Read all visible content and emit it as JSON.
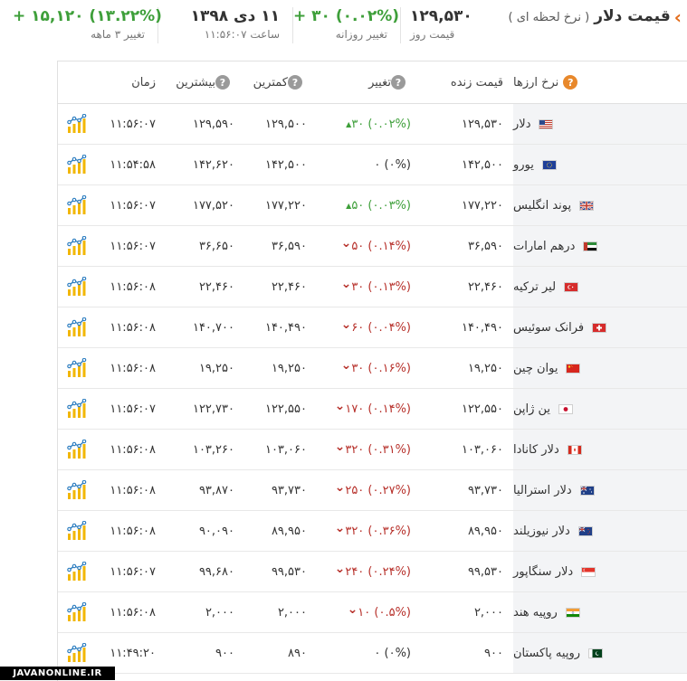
{
  "header": {
    "title": "قیمت دلار",
    "subtitle": "( نرخ لحظه ای )",
    "price": "۱۲۹,۵۳۰",
    "price_label": "قیمت روز",
    "daily_change": "+ ۳۰ (۰.۰۲%)",
    "daily_change_label": "تغییر روزانه",
    "date": "۱۱ دی ۱۳۹۸",
    "time_label": "ساعت ۱۱:۵۶:۰۷",
    "change_3m": "+ ۱۵,۱۲۰ (۱۳.۲۲%)",
    "change_3m_label": "تغییر ۳ ماهه",
    "accent": "#e36c1a",
    "up_color": "#3e9f3a",
    "down_color": "#b7312b"
  },
  "columns": {
    "name": "نرخ ارزها",
    "price": "قیمت زنده",
    "change": "تغییر",
    "min": "کمترین",
    "max": "بیشترین",
    "time": "زمان"
  },
  "rows": [
    {
      "name": "دلار",
      "flag": "us",
      "price": "۱۲۹,۵۳۰",
      "change": "۳۰ (۰.۰۲%)",
      "dir": "up",
      "min": "۱۲۹,۵۰۰",
      "max": "۱۲۹,۵۹۰",
      "time": "۱۱:۵۶:۰۷"
    },
    {
      "name": "یورو",
      "flag": "eu",
      "price": "۱۴۲,۵۰۰",
      "change": "۰ (۰%)",
      "dir": "none",
      "min": "۱۴۲,۵۰۰",
      "max": "۱۴۲,۶۲۰",
      "time": "۱۱:۵۴:۵۸"
    },
    {
      "name": "پوند انگلیس",
      "flag": "gb",
      "price": "۱۷۷,۲۲۰",
      "change": "۵۰ (۰.۰۳%)",
      "dir": "up",
      "min": "۱۷۷,۲۲۰",
      "max": "۱۷۷,۵۲۰",
      "time": "۱۱:۵۶:۰۷"
    },
    {
      "name": "درهم امارات",
      "flag": "ae",
      "price": "۳۶,۵۹۰",
      "change": "۵۰ (۰.۱۴%)",
      "dir": "down",
      "min": "۳۶,۵۹۰",
      "max": "۳۶,۶۵۰",
      "time": "۱۱:۵۶:۰۷"
    },
    {
      "name": "لیر ترکیه",
      "flag": "tr",
      "price": "۲۲,۴۶۰",
      "change": "۳۰ (۰.۱۳%)",
      "dir": "down",
      "min": "۲۲,۴۶۰",
      "max": "۲۲,۴۶۰",
      "time": "۱۱:۵۶:۰۸"
    },
    {
      "name": "فرانک سوئیس",
      "flag": "ch",
      "price": "۱۴۰,۴۹۰",
      "change": "۶۰ (۰.۰۴%)",
      "dir": "down",
      "min": "۱۴۰,۴۹۰",
      "max": "۱۴۰,۷۰۰",
      "time": "۱۱:۵۶:۰۸"
    },
    {
      "name": "یوان چین",
      "flag": "cn",
      "price": "۱۹,۲۵۰",
      "change": "۳۰ (۰.۱۶%)",
      "dir": "down",
      "min": "۱۹,۲۵۰",
      "max": "۱۹,۲۵۰",
      "time": "۱۱:۵۶:۰۸"
    },
    {
      "name": "ین ژاپن",
      "flag": "jp",
      "price": "۱۲۲,۵۵۰",
      "change": "۱۷۰ (۰.۱۴%)",
      "dir": "down",
      "min": "۱۲۲,۵۵۰",
      "max": "۱۲۲,۷۳۰",
      "time": "۱۱:۵۶:۰۷"
    },
    {
      "name": "دلار کانادا",
      "flag": "ca",
      "price": "۱۰۳,۰۶۰",
      "change": "۳۲۰ (۰.۳۱%)",
      "dir": "down",
      "min": "۱۰۳,۰۶۰",
      "max": "۱۰۳,۲۶۰",
      "time": "۱۱:۵۶:۰۸"
    },
    {
      "name": "دلار استرالیا",
      "flag": "au",
      "price": "۹۳,۷۳۰",
      "change": "۲۵۰ (۰.۲۷%)",
      "dir": "down",
      "min": "۹۳,۷۳۰",
      "max": "۹۳,۸۷۰",
      "time": "۱۱:۵۶:۰۸"
    },
    {
      "name": "دلار نیوزیلند",
      "flag": "nz",
      "price": "۸۹,۹۵۰",
      "change": "۳۲۰ (۰.۳۶%)",
      "dir": "down",
      "min": "۸۹,۹۵۰",
      "max": "۹۰,۰۹۰",
      "time": "۱۱:۵۶:۰۸"
    },
    {
      "name": "دلار سنگاپور",
      "flag": "sg",
      "price": "۹۹,۵۳۰",
      "change": "۲۴۰ (۰.۲۴%)",
      "dir": "down",
      "min": "۹۹,۵۳۰",
      "max": "۹۹,۶۸۰",
      "time": "۱۱:۵۶:۰۷"
    },
    {
      "name": "روپیه هند",
      "flag": "in",
      "price": "۲,۰۰۰",
      "change": "۱۰ (۰.۵%)",
      "dir": "down",
      "min": "۲,۰۰۰",
      "max": "۲,۰۰۰",
      "time": "۱۱:۵۶:۰۸"
    },
    {
      "name": "روپیه پاکستان",
      "flag": "pk",
      "price": "۹۰۰",
      "change": "۰ (۰%)",
      "dir": "none",
      "min": "۸۹۰",
      "max": "۹۰۰",
      "time": "۱۱:۴۹:۲۰"
    }
  ],
  "watermark": "JAVANONLINE.IR"
}
